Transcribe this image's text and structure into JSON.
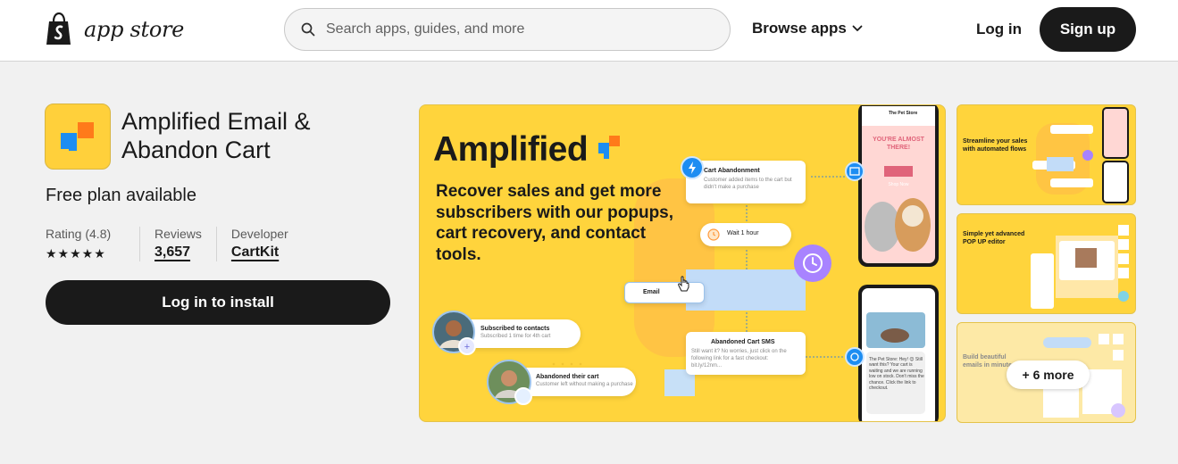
{
  "header": {
    "logo_text": "app store",
    "search_placeholder": "Search apps, guides, and more",
    "browse_label": "Browse apps",
    "login_label": "Log in",
    "signup_label": "Sign up"
  },
  "app": {
    "name": "Amplified Email & Abandon Cart",
    "pricing": "Free plan available",
    "rating_label": "Rating (4.8)",
    "stars": "★★★★★",
    "reviews_label": "Reviews",
    "reviews_count": "3,657",
    "developer_label": "Developer",
    "developer_name": "CartKit",
    "install_label": "Log in to install"
  },
  "hero": {
    "brand": "Amplified",
    "tagline": "Recover sales and get more subscribers with our popups, cart recovery, and contact tools.",
    "flow": {
      "cart_abandonment_title": "Cart Abandonment",
      "cart_abandonment_sub": "Customer added items to the cart but didn't make a purchase",
      "wait_label": "Wait 1 hour",
      "email_label": "Email",
      "sms_title": "Abandoned Cart SMS",
      "sms_sub": "Still want it? No worries, just click on the following link for a fast checkout: bit.ly/12nm...",
      "subscribed_title": "Subscribed to contacts",
      "subscribed_sub": "Subscribed 1 time for 4th cart",
      "abandoned_title": "Abandoned their cart",
      "abandoned_sub": "Customer left without making a purchase"
    },
    "phone": {
      "store_name": "The Pet Store",
      "headline": "YOU'RE ALMOST THERE!",
      "cta": "Shop Now",
      "sms_text": "The Pet Store: Hey! 😊 Still want this? Your cart is waiting and we are running low on stock. Don't miss the chance. Click the link to checkout."
    }
  },
  "thumbnails": [
    {
      "title": "Streamline your sales with automated flows"
    },
    {
      "title": "Simple yet advanced POP UP editor"
    },
    {
      "title": "Build beautiful emails in minutes",
      "more_label": "+ 6 more"
    }
  ],
  "colors": {
    "brand_yellow": "#ffd43c",
    "accent_blue": "#1d8df2",
    "accent_orange": "#ff7a1a",
    "button_dark": "#1a1a1a"
  }
}
